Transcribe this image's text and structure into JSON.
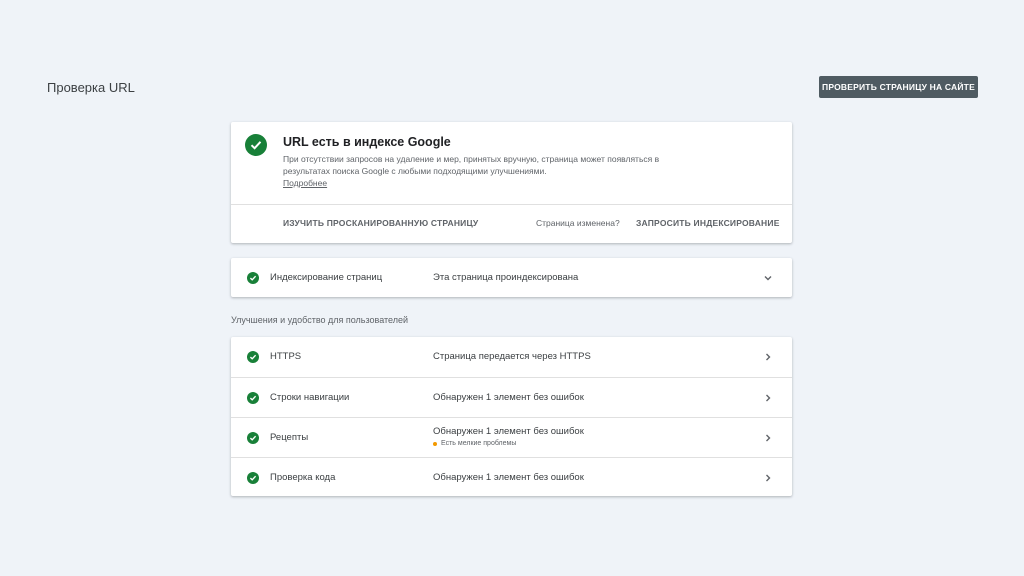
{
  "header": {
    "title": "Проверка URL",
    "live_test_label": "ПРОВЕРИТЬ СТРАНИЦУ НА САЙТЕ"
  },
  "status": {
    "title": "URL есть в индексе Google",
    "description": "При отсутствии запросов на удаление и мер, принятых вручную, страница может появляться в результатах поиска Google с любыми подходящими улучшениями.",
    "more_link": "Подробнее",
    "crawled_label": "ИЗУЧИТЬ ПРОСКАНИРОВАННУЮ СТРАНИЦУ",
    "changed_question": "Страница изменена?",
    "request_label": "ЗАПРОСИТЬ ИНДЕКСИРОВАНИЕ",
    "icon": "check-circle-icon",
    "color": "#188038"
  },
  "indexing": {
    "label": "Индексирование страниц",
    "value": "Эта страница проиндексирована"
  },
  "enhancements": {
    "section_label": "Улучшения и удобство для пользователей",
    "rows": [
      {
        "label": "HTTPS",
        "value": "Страница передается через HTTPS",
        "sub": ""
      },
      {
        "label": "Строки навигации",
        "value": "Обнаружен 1 элемент без ошибок",
        "sub": ""
      },
      {
        "label": "Рецепты",
        "value": "Обнаружен 1 элемент без ошибок",
        "sub": "Есть мелкие проблемы"
      },
      {
        "label": "Проверка кода",
        "value": "Обнаружен 1 элемент без ошибок",
        "sub": ""
      }
    ]
  },
  "colors": {
    "page_bg": "#eff3f8",
    "success": "#188038",
    "warning": "#f29900",
    "button_dark": "#4f5b62"
  }
}
